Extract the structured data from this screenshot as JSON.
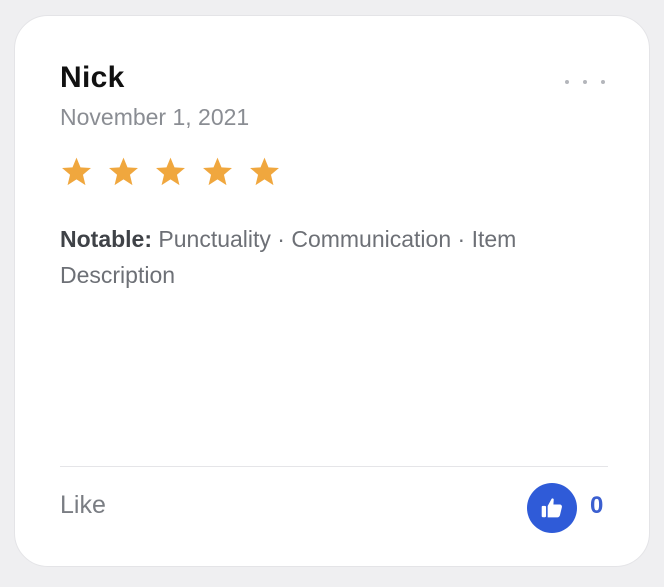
{
  "review": {
    "reviewer_name": "Nick",
    "date": "November 1, 2021",
    "rating": 5,
    "rating_max": 5,
    "star_color": "#F0A73E",
    "notable_label": "Notable:",
    "notable_text": " Punctuality · Communication · Item Description"
  },
  "footer": {
    "like_label": "Like",
    "like_count": "0",
    "like_icon": "thumbs-up-icon",
    "accent_color": "#2F5BD8"
  },
  "menu": {
    "icon": "more-horizontal-icon"
  }
}
